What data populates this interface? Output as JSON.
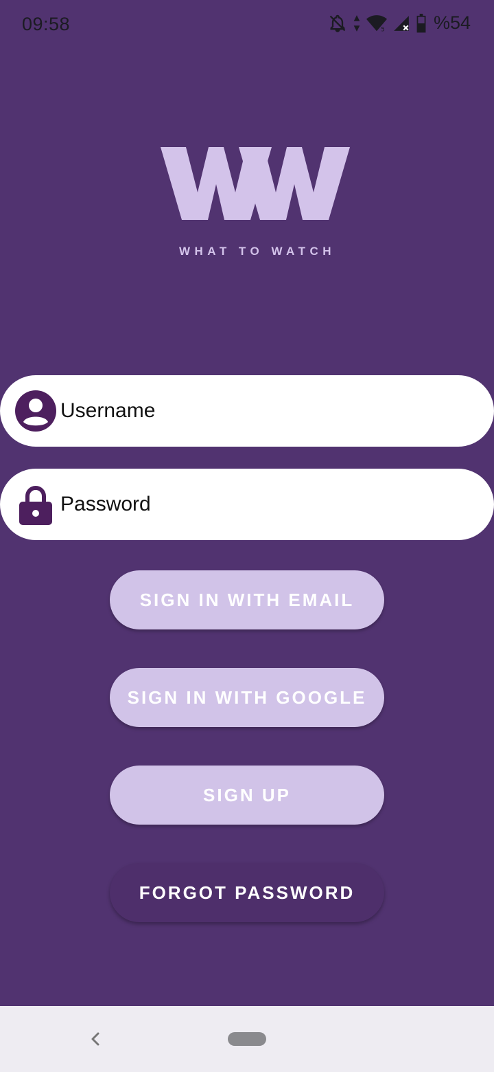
{
  "status_bar": {
    "time": "09:58",
    "battery_percent": "%54",
    "icons": [
      "notifications-off-icon",
      "data-updown-icon",
      "wifi-icon",
      "signal-icon",
      "battery-icon"
    ]
  },
  "logo": {
    "mark": "WW",
    "tagline": "WHAT TO WATCH",
    "color": "#d3c3ea"
  },
  "form": {
    "username": {
      "placeholder": "Username",
      "value": "",
      "icon": "account-circle-icon"
    },
    "password": {
      "placeholder": "Password",
      "value": "",
      "icon": "lock-icon"
    }
  },
  "buttons": {
    "sign_in_email": "SIGN IN WITH EMAIL",
    "sign_in_google": "SIGN IN WITH GOOGLE",
    "sign_up": "SIGN UP",
    "forgot_password": "FORGOT PASSWORD"
  },
  "colors": {
    "background": "#513370",
    "button_light": "#d1c3e8",
    "button_dark": "#4e2f6b",
    "icon_accent": "#4d1f5e"
  },
  "nav_bar": {
    "icons": [
      "back-icon",
      "home-pill-icon"
    ]
  }
}
